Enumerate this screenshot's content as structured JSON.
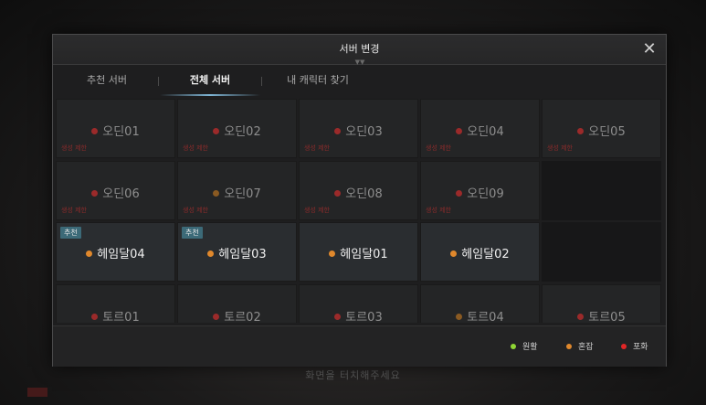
{
  "background": {
    "hint_text": "화면을 터치해주세요"
  },
  "modal": {
    "title": "서버 변경",
    "close_glyph": "✕",
    "tabs": [
      {
        "label": "추천 서버",
        "active": false
      },
      {
        "label": "전체 서버",
        "active": true
      },
      {
        "label": "내 캐릭터 찾기",
        "active": false
      }
    ]
  },
  "colors": {
    "smooth": "#8fd634",
    "busy": "#e0882c",
    "full": "#e02626",
    "dot_red": "#9b2a2a",
    "dot_brown": "#8a5a22"
  },
  "servers": {
    "row1": [
      {
        "name": "오딘01",
        "status_dot": "dot_red",
        "sub": "생성 제한"
      },
      {
        "name": "오딘02",
        "status_dot": "dot_red",
        "sub": "생성 제한"
      },
      {
        "name": "오딘03",
        "status_dot": "dot_red",
        "sub": "생성 제한"
      },
      {
        "name": "오딘04",
        "status_dot": "dot_red",
        "sub": "생성 제한"
      },
      {
        "name": "오딘05",
        "status_dot": "dot_red",
        "sub": "생성 제한"
      }
    ],
    "row2": [
      {
        "name": "오딘06",
        "status_dot": "dot_red",
        "sub": "생성 제한"
      },
      {
        "name": "오딘07",
        "status_dot": "dot_brown",
        "sub": "생성 제한"
      },
      {
        "name": "오딘08",
        "status_dot": "dot_red",
        "sub": "생성 제한"
      },
      {
        "name": "오딘09",
        "status_dot": "dot_red",
        "sub": "생성 제한"
      }
    ],
    "row3": [
      {
        "name": "헤임달04",
        "status_dot": "busy",
        "badge": "추천"
      },
      {
        "name": "헤임달03",
        "status_dot": "busy",
        "badge": "추천"
      },
      {
        "name": "헤임달01",
        "status_dot": "busy"
      },
      {
        "name": "헤임달02",
        "status_dot": "busy"
      }
    ],
    "row4": [
      {
        "name": "토르01",
        "status_dot": "dot_red"
      },
      {
        "name": "토르02",
        "status_dot": "dot_red"
      },
      {
        "name": "토르03",
        "status_dot": "dot_red"
      },
      {
        "name": "토르04",
        "status_dot": "dot_brown"
      },
      {
        "name": "토르05",
        "status_dot": "dot_red"
      }
    ]
  },
  "legend": [
    {
      "label": "원활",
      "color": "smooth"
    },
    {
      "label": "혼잡",
      "color": "busy"
    },
    {
      "label": "포화",
      "color": "full"
    }
  ]
}
